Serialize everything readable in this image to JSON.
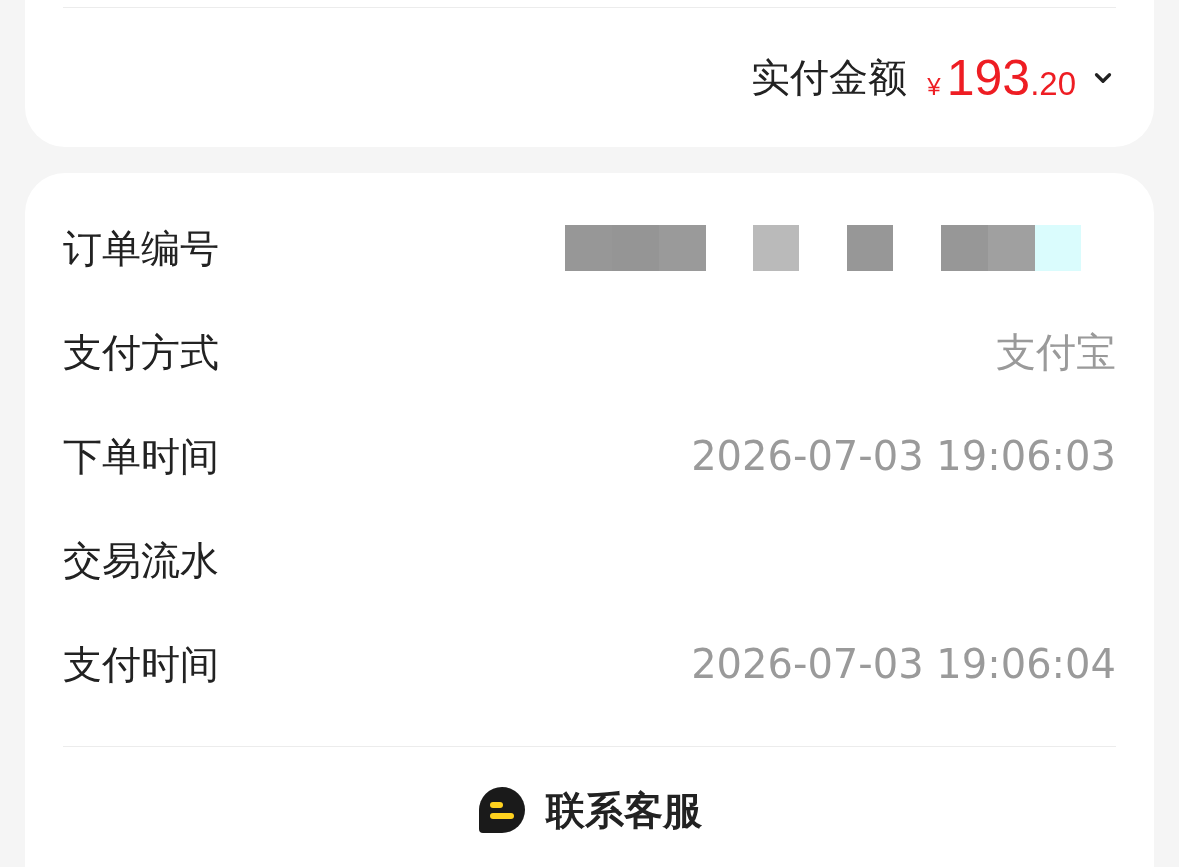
{
  "summary": {
    "label": "实付金额",
    "currency": "¥",
    "amount_integer": "193",
    "amount_decimal": ".20",
    "expanded": false
  },
  "order_info": {
    "rows": [
      {
        "kind": "redacted",
        "label": "订单编号"
      },
      {
        "kind": "text",
        "label": "支付方式",
        "value": "支付宝"
      },
      {
        "kind": "text",
        "label": "下单时间",
        "value": "2026-07-03 19:06:03"
      },
      {
        "kind": "text",
        "label": "交易流水"
      },
      {
        "kind": "text",
        "label": "支付时间",
        "value": "2026-07-03 19:06:04"
      }
    ]
  },
  "contact_button": {
    "label": "联系客服"
  }
}
